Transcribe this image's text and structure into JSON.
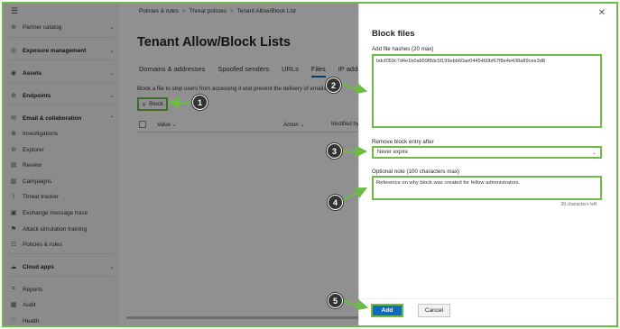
{
  "nav": {
    "items": [
      {
        "label": "Partner catalog",
        "icon": "⊚",
        "chevron": "⌄",
        "group": false
      },
      {
        "label": "Exposure management",
        "icon": "◎",
        "chevron": "⌄",
        "group": true
      },
      {
        "label": "Assets",
        "icon": "◉",
        "chevron": "⌄",
        "group": true
      },
      {
        "label": "Endpoints",
        "icon": "⊛",
        "chevron": "⌄",
        "group": true
      },
      {
        "label": "Email & collaboration",
        "icon": "✉",
        "chevron": "⌃",
        "group": true
      },
      {
        "label": "Investigations",
        "icon": "⊕",
        "chevron": "",
        "group": false
      },
      {
        "label": "Explorer",
        "icon": "⊘",
        "chevron": "",
        "group": false
      },
      {
        "label": "Review",
        "icon": "▤",
        "chevron": "",
        "group": false
      },
      {
        "label": "Campaigns",
        "icon": "▥",
        "chevron": "",
        "group": false
      },
      {
        "label": "Threat tracker",
        "icon": "⌇",
        "chevron": "",
        "group": false
      },
      {
        "label": "Exchange message trace",
        "icon": "▣",
        "chevron": "",
        "group": false
      },
      {
        "label": "Attack simulation training",
        "icon": "⚑",
        "chevron": "",
        "group": false
      },
      {
        "label": "Policies & rules",
        "icon": "☷",
        "chevron": "",
        "group": false
      },
      {
        "label": "Cloud apps",
        "icon": "☁",
        "chevron": "⌄",
        "group": true
      },
      {
        "label": "Reports",
        "icon": "⌗",
        "chevron": "",
        "group": false
      },
      {
        "label": "Audit",
        "icon": "▦",
        "chevron": "",
        "group": false
      },
      {
        "label": "Health",
        "icon": "♡",
        "chevron": "",
        "group": false
      }
    ]
  },
  "breadcrumb": [
    "Policies & rules",
    "Threat policies",
    "Tenant Allow/Block List"
  ],
  "page_title": "Tenant Allow/Block Lists",
  "tabs": [
    "Domains & addresses",
    "Spoofed senders",
    "URLs",
    "Files",
    "IP addresses"
  ],
  "active_tab": "Files",
  "description": "Block a file to stop users from accessing it and prevent the delivery of emails",
  "block_button": "Block",
  "table_headers": {
    "value": "Value ⌄",
    "action": "Action ⌄",
    "modified": "Modified by"
  },
  "panel": {
    "title": "Block files",
    "hash_label": "Add file hashes (20 max)",
    "hash_value": "bdcf059c7d4e1b0ab59f8dc5f199ebb60ae0445460bf67f8e4e438a89cee3d8",
    "remove_label": "Remove block entry after",
    "remove_value": "Never expire",
    "note_label": "Optional note (100 characters max)",
    "note_value": "Reference on why block was created for fellow administrators.",
    "chars_left": "39 characters left",
    "add": "Add",
    "cancel": "Cancel"
  },
  "callouts": [
    "1",
    "2",
    "3",
    "4",
    "5"
  ],
  "colors": {
    "highlight": "#6dbb46",
    "primary": "#0f6cbd",
    "callout": "#333333"
  }
}
